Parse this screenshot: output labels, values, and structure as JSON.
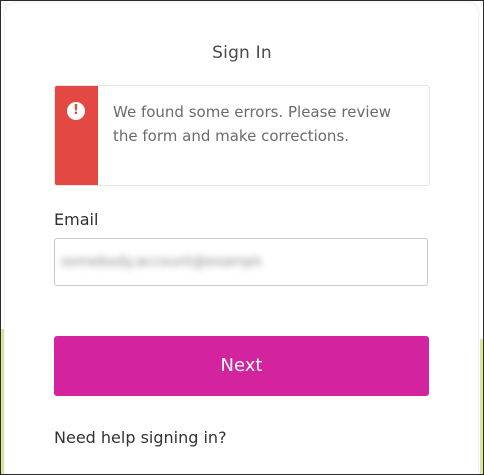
{
  "page": {
    "title": "Sign In"
  },
  "error": {
    "icon": "alert-icon",
    "glyph": "!",
    "message": "We found some errors. Please review the form and make corrections."
  },
  "email": {
    "label": "Email",
    "value": "somebody.account@example.com"
  },
  "actions": {
    "next_label": "Next",
    "help_label": "Need help signing in?"
  },
  "colors": {
    "accent": "#d4239f",
    "error": "#e34843",
    "side_accent": "#d9e89a"
  }
}
